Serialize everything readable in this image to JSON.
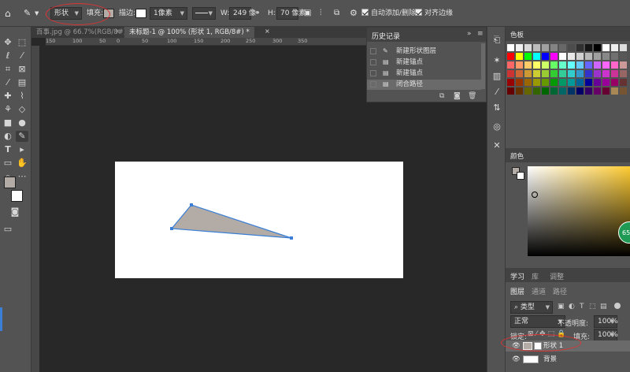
{
  "options_bar": {
    "mode_value": "形状",
    "fill_label": "填充:",
    "stroke_label": "描边:",
    "stroke_width_value": "1像素",
    "w_label": "W:",
    "w_value": "249 像",
    "h_label": "H:",
    "h_value": "70 像素",
    "auto_add_delete_label": "自动添加/删除",
    "align_edges_label": "对齐边缘"
  },
  "tabs": [
    {
      "label": "百事.jpg @ 66.7%(RGB/8#)",
      "active": false
    },
    {
      "label": "未标题-1 @ 100% (形状 1, RGB/8#) *",
      "active": true
    }
  ],
  "ruler_marks": [
    "150",
    "100",
    "50",
    "0",
    "50",
    "100",
    "150",
    "200",
    "250",
    "300",
    "350"
  ],
  "history": {
    "title": "历史记录",
    "items": [
      {
        "label": "新建形状图层",
        "active": false
      },
      {
        "label": "新建锚点",
        "active": false
      },
      {
        "label": "新建锚点",
        "active": false
      },
      {
        "label": "闭合路径",
        "active": true
      }
    ]
  },
  "swatches_panel": {
    "title": "色板"
  },
  "color_panel": {
    "title": "颜色"
  },
  "learn_tabs": [
    "学习",
    "库",
    "调整"
  ],
  "layers_panel": {
    "tabs": [
      "图层",
      "通道",
      "路径"
    ],
    "kind_filter": "类型",
    "blend_mode": "正常",
    "opacity_label": "不透明度:",
    "opacity_value": "100%",
    "lock_label": "锁定:",
    "fill_label": "填充:",
    "fill_value": "100%",
    "layers": [
      {
        "name": "形状 1",
        "selected": true
      },
      {
        "name": "背景",
        "selected": false
      }
    ]
  },
  "colors": {
    "accent": "#3a7fd5",
    "annotation": "#dd3333",
    "shape_fill": "#b3aca6",
    "picker_hue": "#ffcc33"
  },
  "color_picker_badge": "65"
}
